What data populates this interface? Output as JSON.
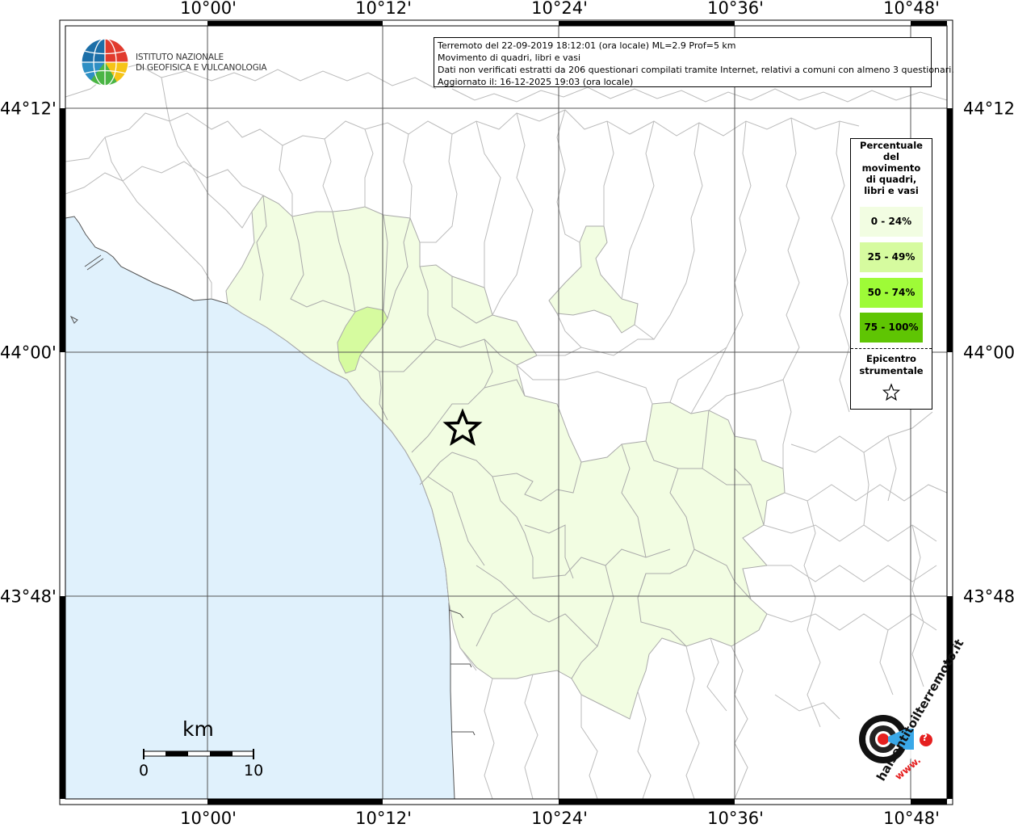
{
  "map": {
    "lon_ticks": [
      "10°00'",
      "10°12'",
      "10°24'",
      "10°36'",
      "10°48'"
    ],
    "lat_ticks": [
      "44°12'",
      "44°00'",
      "43°48'"
    ],
    "colors": {
      "sea": "#e0f1fc",
      "land": "#ffffff",
      "boundary": "#bbbbbb",
      "grid": "#555555",
      "class_0_24": "#f2fde2",
      "class_25_49": "#d6fb9f",
      "class_50_74": "#9efb37",
      "class_75_100": "#5fc503"
    }
  },
  "logo": {
    "line1": "ISTITUTO NAZIONALE",
    "line2": "DI GEOFISICA E VULCANOLOGIA"
  },
  "info": {
    "line1": "Terremoto del 22-09-2019 18:12:01 (ora locale) ML=2.9 Prof=5 km",
    "line2": "Movimento di quadri, libri e vasi",
    "line3": "Dati non verificati estratti da 206 questionari compilati tramite Internet, relativi a comuni con almeno 3 questionari.",
    "line4": "Aggiornato il: 16-12-2025 19:03 (ora locale)"
  },
  "legend": {
    "title": [
      "Percentuale",
      "del",
      "movimento",
      "di quadri,",
      "libri e vasi"
    ],
    "classes": [
      {
        "label": "0 - 24%",
        "color": "#f2fde2"
      },
      {
        "label": "25 - 49%",
        "color": "#d6fb9f"
      },
      {
        "label": "50 - 74%",
        "color": "#9efb37"
      },
      {
        "label": "75 - 100%",
        "color": "#5fc503"
      }
    ],
    "epicenter_title": [
      "Epicentro",
      "strumentale"
    ],
    "epicenter_icon": "star-outline-icon"
  },
  "scale": {
    "unit": "km",
    "min": "0",
    "max": "10"
  },
  "badge": {
    "text": "haisentitoilterremoto.it",
    "url": "www.",
    "question": "?"
  }
}
